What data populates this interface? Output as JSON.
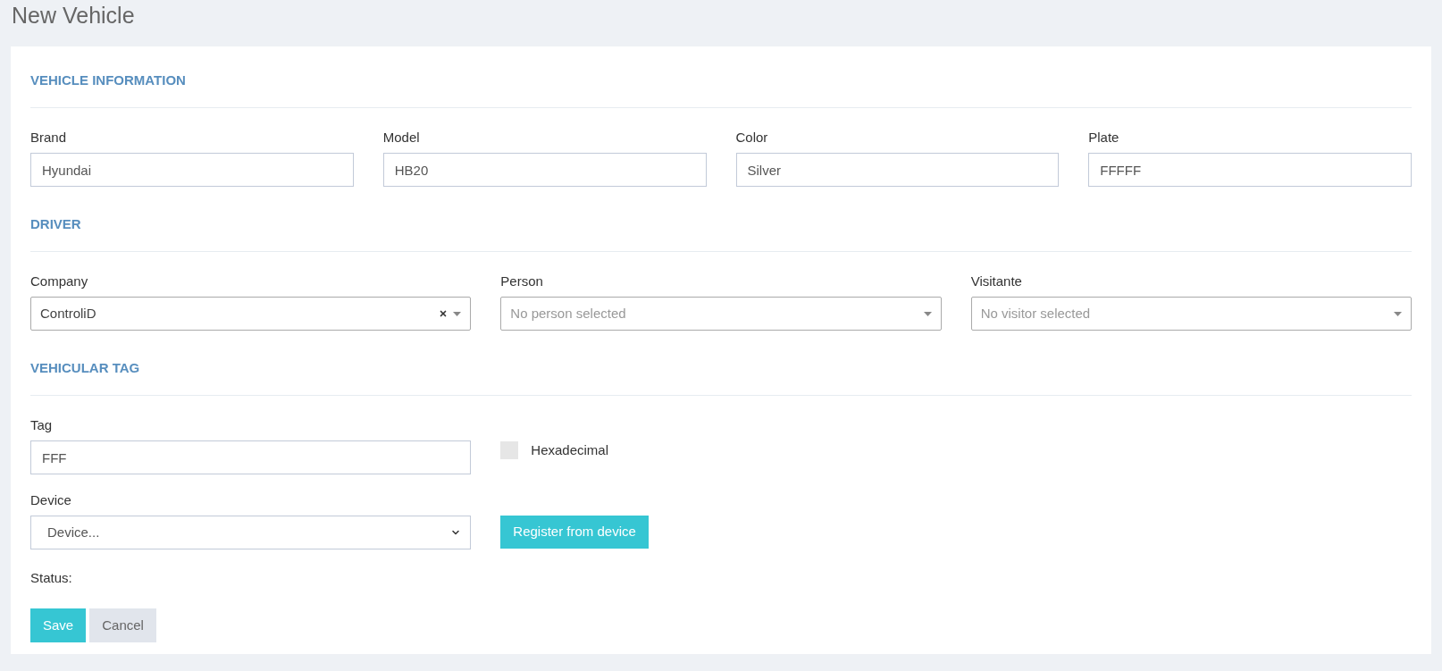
{
  "page_title": "New Vehicle",
  "vehicle_information": {
    "title": "VEHICLE INFORMATION",
    "fields": [
      {
        "label": "Brand",
        "value": "Hyundai"
      },
      {
        "label": "Model",
        "value": "HB20"
      },
      {
        "label": "Color",
        "value": "Silver"
      },
      {
        "label": "Plate",
        "value": "FFFFF"
      }
    ]
  },
  "driver": {
    "title": "DRIVER",
    "selects": [
      {
        "label": "Company",
        "value": "ControliD",
        "clearable": true
      },
      {
        "label": "Person",
        "placeholder": "No person selected",
        "clearable": false
      },
      {
        "label": "Visitante",
        "placeholder": "No visitor selected",
        "clearable": false
      }
    ]
  },
  "vehicular_tag": {
    "title": "VEHICULAR TAG",
    "tag": {
      "label": "Tag",
      "value": "FFF"
    },
    "hexadecimal": {
      "label": "Hexadecimal",
      "checked": false
    },
    "device": {
      "label": "Device",
      "value": "Device..."
    },
    "register_button": "Register from device",
    "status_label": "Status:"
  },
  "buttons": [
    {
      "label": "Save",
      "kind": "primary"
    },
    {
      "label": "Cancel",
      "kind": "secondary"
    }
  ]
}
